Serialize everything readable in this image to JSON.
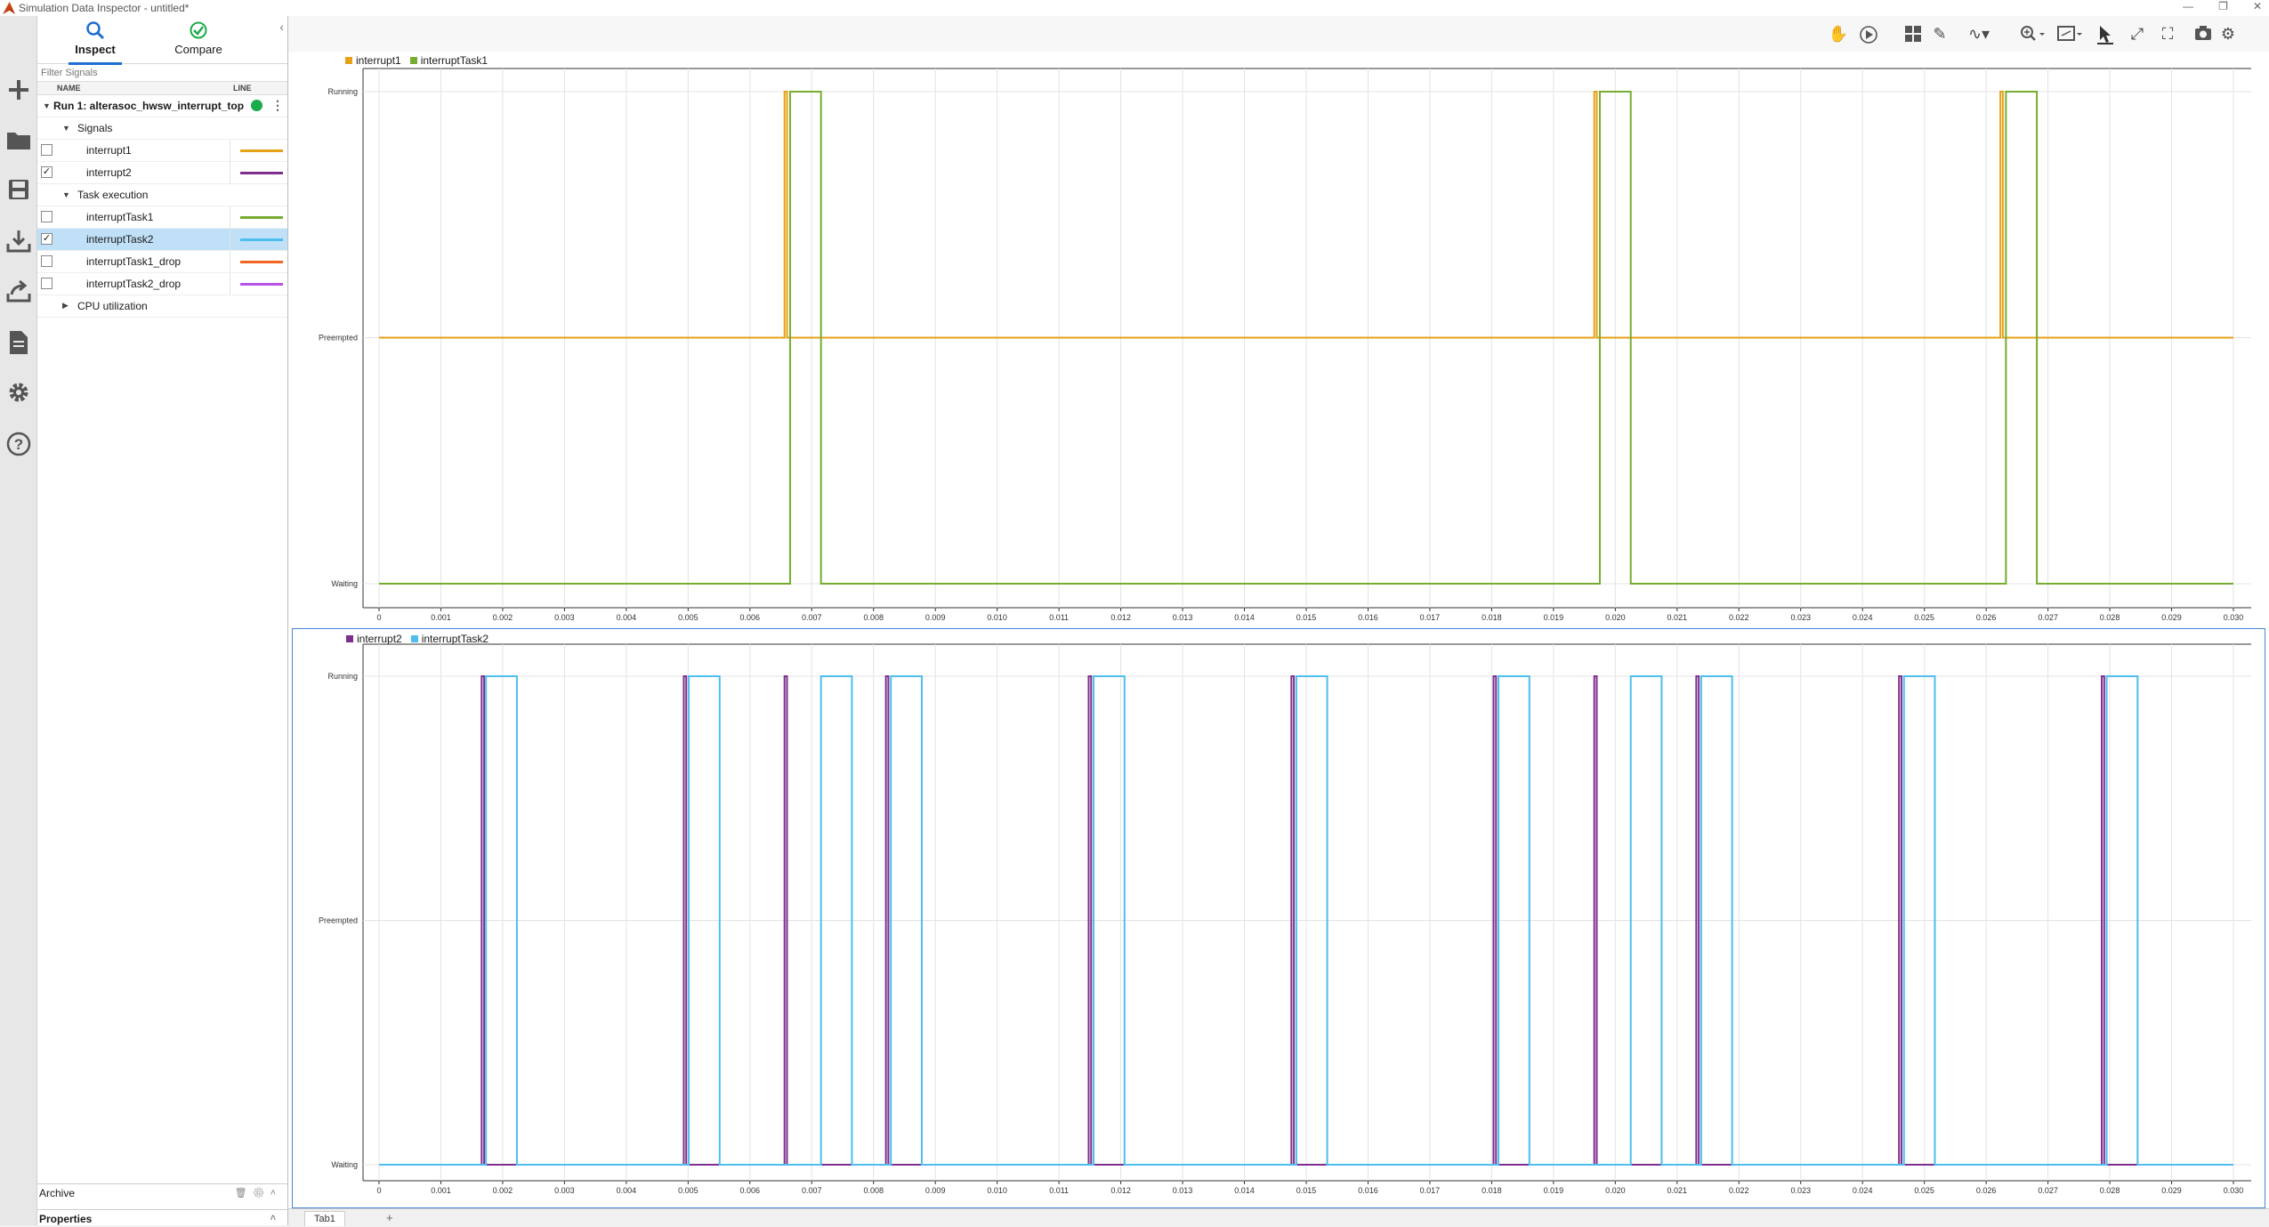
{
  "window": {
    "title": "Simulation Data Inspector - untitled*"
  },
  "left_bar": {
    "icons": [
      "plus-icon",
      "folder-icon",
      "save-icon",
      "import-icon",
      "export-icon",
      "report-icon",
      "settings-icon",
      "help-icon"
    ]
  },
  "modes": {
    "inspect_label": "Inspect",
    "compare_label": "Compare"
  },
  "filter": {
    "placeholder": "Filter Signals"
  },
  "columns": {
    "name": "NAME",
    "line": "LINE"
  },
  "tree": {
    "run_label": "Run 1: alterasoc_hwsw_interrupt_top",
    "groups": [
      {
        "label": "Signals",
        "expanded": true,
        "signals": [
          {
            "name": "interrupt1",
            "checked": false,
            "color": "#e6a117"
          },
          {
            "name": "interrupt2",
            "checked": true,
            "color": "#7e2f8e"
          }
        ]
      },
      {
        "label": "Task execution",
        "expanded": true,
        "signals": [
          {
            "name": "interruptTask1",
            "checked": false,
            "color": "#77ac30"
          },
          {
            "name": "interruptTask2",
            "checked": true,
            "color": "#4dbeee",
            "selected": true
          },
          {
            "name": "interruptTask1_drop",
            "checked": false,
            "color": "#f26522"
          },
          {
            "name": "interruptTask2_drop",
            "checked": false,
            "color": "#b653e6"
          }
        ]
      },
      {
        "label": "CPU utilization",
        "expanded": false,
        "signals": []
      }
    ]
  },
  "archive_label": "Archive",
  "properties_label": "Properties",
  "tab_label": "Tab1",
  "chart_data": [
    {
      "type": "line",
      "step": true,
      "title": "",
      "xlabel": "",
      "ylabel": "",
      "xlim": [
        0,
        0.03
      ],
      "x_ticks": [
        "0",
        "0.001",
        "0.002",
        "0.003",
        "0.004",
        "0.005",
        "0.006",
        "0.007",
        "0.008",
        "0.009",
        "0.010",
        "0.011",
        "0.012",
        "0.013",
        "0.014",
        "0.015",
        "0.016",
        "0.017",
        "0.018",
        "0.019",
        "0.020",
        "0.021",
        "0.022",
        "0.023",
        "0.024",
        "0.025",
        "0.026",
        "0.027",
        "0.028",
        "0.029",
        "0.030"
      ],
      "y_categories": [
        "Waiting",
        "Preempted",
        "Running"
      ],
      "grid": true,
      "legend": "top-left",
      "series": [
        {
          "name": "interrupt1",
          "color": "#e6a117",
          "default": 1,
          "pulses": [
            [
              0.00656,
              0.0066
            ],
            [
              0.01966,
              0.0197
            ],
            [
              0.02623,
              0.02627
            ]
          ]
        },
        {
          "name": "interruptTask1",
          "color": "#77ac30",
          "default": 0,
          "pulses": [
            [
              0.00665,
              0.00715
            ],
            [
              0.01975,
              0.02025
            ],
            [
              0.02632,
              0.02682
            ]
          ]
        }
      ]
    },
    {
      "type": "line",
      "step": true,
      "title": "",
      "xlabel": "",
      "ylabel": "",
      "xlim": [
        0,
        0.03
      ],
      "x_ticks": [
        "0",
        "0.001",
        "0.002",
        "0.003",
        "0.004",
        "0.005",
        "0.006",
        "0.007",
        "0.008",
        "0.009",
        "0.010",
        "0.011",
        "0.012",
        "0.013",
        "0.014",
        "0.015",
        "0.016",
        "0.017",
        "0.018",
        "0.019",
        "0.020",
        "0.021",
        "0.022",
        "0.023",
        "0.024",
        "0.025",
        "0.026",
        "0.027",
        "0.028",
        "0.029",
        "0.030"
      ],
      "y_categories": [
        "Waiting",
        "Preempted",
        "Running"
      ],
      "grid": true,
      "legend": "top-left",
      "series": [
        {
          "name": "interrupt2",
          "color": "#7e2f8e",
          "default": 0,
          "pulses": [
            [
              0.00166,
              0.0017
            ],
            [
              0.00493,
              0.00497
            ],
            [
              0.00656,
              0.0066
            ],
            [
              0.0082,
              0.00824
            ],
            [
              0.01148,
              0.01152
            ],
            [
              0.01476,
              0.0148
            ],
            [
              0.01803,
              0.01807
            ],
            [
              0.01966,
              0.0197
            ],
            [
              0.02131,
              0.02135
            ],
            [
              0.02459,
              0.02463
            ],
            [
              0.02787,
              0.02791
            ]
          ]
        },
        {
          "name": "interruptTask2",
          "color": "#4dbeee",
          "default": 0,
          "pulses": [
            [
              0.00173,
              0.00223
            ],
            [
              0.00501,
              0.00551
            ],
            [
              0.00715,
              0.00765
            ],
            [
              0.00828,
              0.00878
            ],
            [
              0.01156,
              0.01206
            ],
            [
              0.01484,
              0.01534
            ],
            [
              0.01811,
              0.01861
            ],
            [
              0.02025,
              0.02075
            ],
            [
              0.02139,
              0.02189
            ],
            [
              0.02467,
              0.02517
            ],
            [
              0.02795,
              0.02845
            ]
          ]
        }
      ]
    }
  ]
}
